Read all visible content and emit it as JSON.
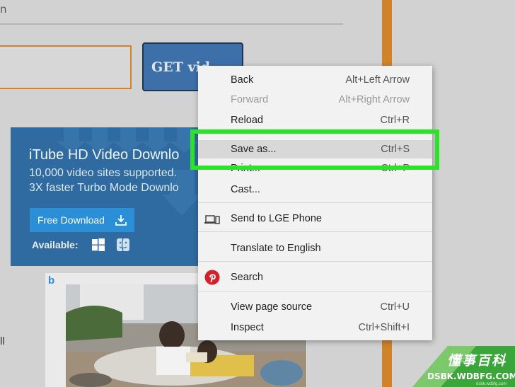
{
  "page": {
    "top_fragment": "n",
    "left_fragment": "ll",
    "get_video_label": "GET vid"
  },
  "ad": {
    "title": "iTube HD Video Downlo",
    "line1": "10,000 video sites supported.",
    "line2": "3X faster Turbo Mode Downlo",
    "button_label": "Free Download",
    "available_label": "Available:",
    "icons": [
      "download-icon",
      "windows-icon",
      "mac-finder-icon"
    ]
  },
  "context_menu": {
    "items": [
      {
        "label": "Back",
        "shortcut": "Alt+Left Arrow",
        "disabled": false
      },
      {
        "label": "Forward",
        "shortcut": "Alt+Right Arrow",
        "disabled": true
      },
      {
        "label": "Reload",
        "shortcut": "Ctrl+R",
        "disabled": false
      },
      {
        "label": "Save as...",
        "shortcut": "Ctrl+S",
        "disabled": false,
        "highlighted": true
      },
      {
        "label": "Print...",
        "shortcut": "Ctrl+P",
        "disabled": false
      },
      {
        "label": "Cast...",
        "shortcut": "",
        "disabled": false
      },
      {
        "label": "Send to LGE Phone",
        "shortcut": "",
        "icon": "device-icon"
      },
      {
        "label": "Translate to English",
        "shortcut": ""
      },
      {
        "label": "Search",
        "shortcut": "",
        "icon": "pinterest-icon"
      },
      {
        "label": "View page source",
        "shortcut": "Ctrl+U"
      },
      {
        "label": "Inspect",
        "shortcut": "Ctrl+Shift+I"
      }
    ]
  },
  "watermark": {
    "title": "懂事百科",
    "domain": "DSBK.WDBFG.COM",
    "small": "dsbk.wdbfg.com"
  },
  "colors": {
    "highlight_frame": "#2ee22b",
    "ad_background": "#2f6ba0",
    "get_video_button": "#3d6fa9",
    "orange_accent": "#d1832a"
  }
}
